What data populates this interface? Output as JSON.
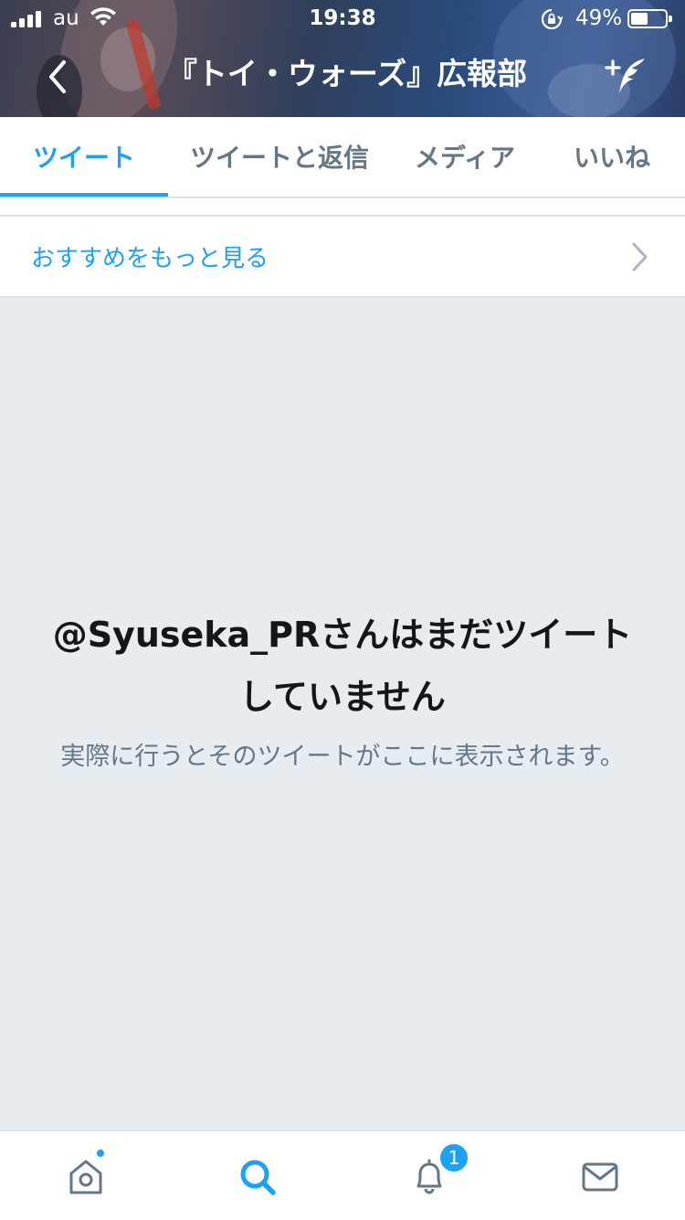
{
  "status_bar": {
    "carrier": "au",
    "time": "19:38",
    "battery_percent": "49%",
    "battery_level": 0.49,
    "signal_bars": 4
  },
  "header": {
    "title": "『トイ・ウォーズ』広報部",
    "back_icon": "chevron-left-icon",
    "compose_icon": "compose-tweet-icon"
  },
  "tabs": [
    {
      "label": "ツイート",
      "active": true
    },
    {
      "label": "ツイートと返信",
      "active": false
    },
    {
      "label": "メディア",
      "active": false
    },
    {
      "label": "いいね",
      "active": false
    }
  ],
  "recommendations": {
    "label": "おすすめをもっと見る"
  },
  "empty_state": {
    "title": "@Syuseka_PRさんはまだツイートしていません",
    "body": "実際に行うとそのツイートがここに表示されます。"
  },
  "tab_bar": {
    "items": [
      {
        "name": "home",
        "icon": "home-icon"
      },
      {
        "name": "search",
        "icon": "search-icon",
        "active": true
      },
      {
        "name": "notifications",
        "icon": "bell-icon",
        "badge": "1"
      },
      {
        "name": "messages",
        "icon": "envelope-icon"
      }
    ]
  },
  "colors": {
    "accent": "#1da1f2",
    "text_secondary": "#657786",
    "background": "#e6ecf0"
  }
}
